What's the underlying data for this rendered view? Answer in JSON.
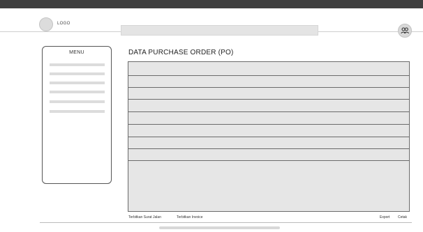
{
  "header": {
    "logo_text": "LOGO"
  },
  "menu": {
    "title": "MENU",
    "item_count_visible": 6
  },
  "main": {
    "title": "DATA PURCHASE ORDER (PO)"
  },
  "actions": {
    "surat_jalan": "Terbitkan Surat Jalan",
    "invoice": "Terbitkan Invoice",
    "export": "Export",
    "cetak": "Cetak"
  },
  "icons": {
    "user": "users-icon"
  }
}
